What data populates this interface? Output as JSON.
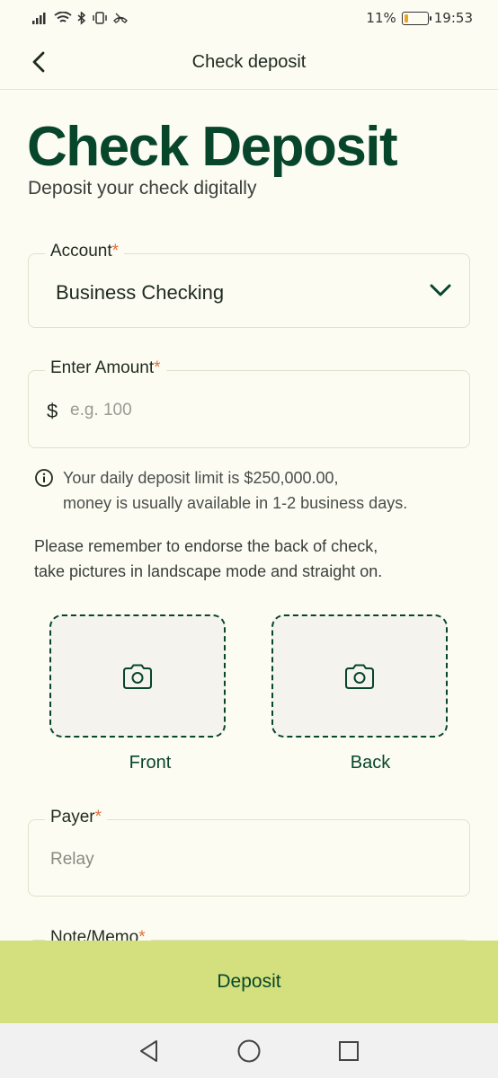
{
  "status_bar": {
    "battery_percent": "11%",
    "time": "19:53"
  },
  "header": {
    "title": "Check deposit"
  },
  "page": {
    "title": "Check Deposit",
    "subtitle": "Deposit your check digitally"
  },
  "account": {
    "label": "Account",
    "required_mark": "*",
    "value": "Business Checking"
  },
  "amount": {
    "label": "Enter Amount",
    "required_mark": "*",
    "currency_symbol": "$",
    "placeholder": "e.g. 100"
  },
  "info": {
    "line1": "Your daily deposit limit is $250,000.00,",
    "line2": "money is usually available in 1-2 business days."
  },
  "reminder": {
    "line1": "Please remember to endorse the back of check,",
    "line2": "take pictures in landscape mode and straight on."
  },
  "photos": {
    "front_label": "Front",
    "back_label": "Back"
  },
  "payer": {
    "label": "Payer",
    "required_mark": "*",
    "value": "Relay"
  },
  "memo": {
    "label": "Note/Memo",
    "required_mark": "*"
  },
  "deposit_button": {
    "label": "Deposit"
  },
  "colors": {
    "brand_green": "#07462A",
    "accent_lime": "#D4E07E",
    "required_orange": "#E0703A",
    "background": "#FCFCF3"
  },
  "icons": {
    "back": "chevron-left-icon",
    "dropdown": "chevron-down-icon",
    "info": "info-icon",
    "camera": "camera-icon",
    "nav_back": "triangle-back-icon",
    "nav_home": "circle-home-icon",
    "nav_recents": "square-recents-icon"
  }
}
